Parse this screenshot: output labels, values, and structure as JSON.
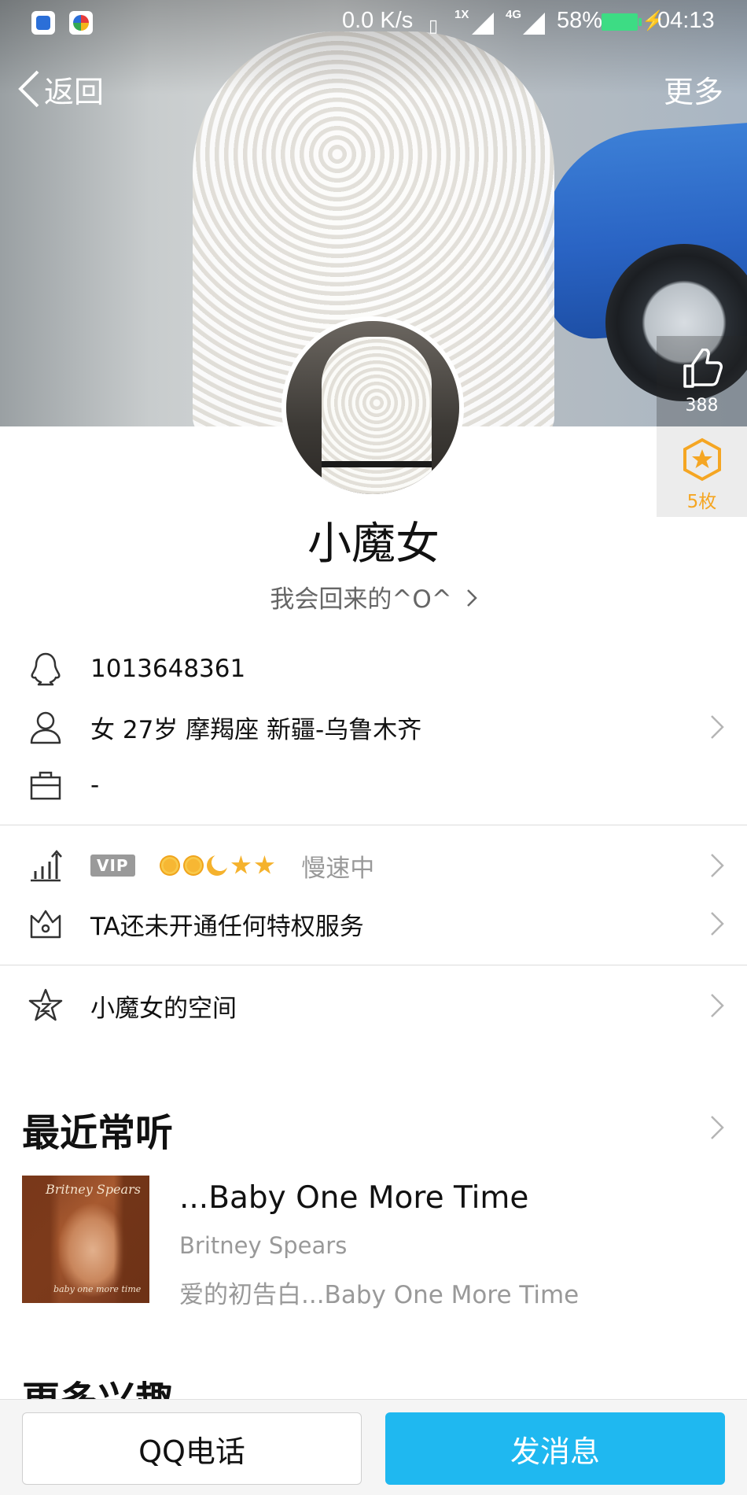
{
  "status_bar": {
    "network_speed": "0.0 K/s",
    "signal_1_label": "1X",
    "signal_2_label": "4G",
    "battery_percent": "58%",
    "time": "04:13"
  },
  "nav": {
    "back_label": "返回",
    "more_label": "更多"
  },
  "side": {
    "likes": "388",
    "medals": "5枚"
  },
  "profile": {
    "name": "小魔女",
    "signature": "我会回来的^O^"
  },
  "info": {
    "qq_number": "1013648361",
    "personal": "女  27岁  摩羯座  新疆-乌鲁木齐",
    "occupation": "-"
  },
  "level": {
    "vip_badge": "VIP",
    "level_icons": [
      "sun-icon",
      "sun-icon",
      "moon-icon",
      "star-icon",
      "star-icon"
    ],
    "speed_status": "慢速中"
  },
  "privilege": {
    "text": "TA还未开通任何特权服务"
  },
  "space": {
    "text": "小魔女的空间"
  },
  "recent": {
    "title": "最近常听",
    "song_title": "...Baby One More Time",
    "artist": "Britney Spears",
    "album": "爱的初告白...Baby One More Time",
    "cover_artist_script": "Britney Spears",
    "cover_album_script": "baby one more time"
  },
  "more_interests": {
    "title": "更多兴趣"
  },
  "bottom": {
    "call_label": "QQ电话",
    "message_label": "发消息"
  },
  "colors": {
    "accent_blue": "#1fb8f0",
    "medal_orange": "#f5a623",
    "battery_green": "#3ddc84"
  }
}
